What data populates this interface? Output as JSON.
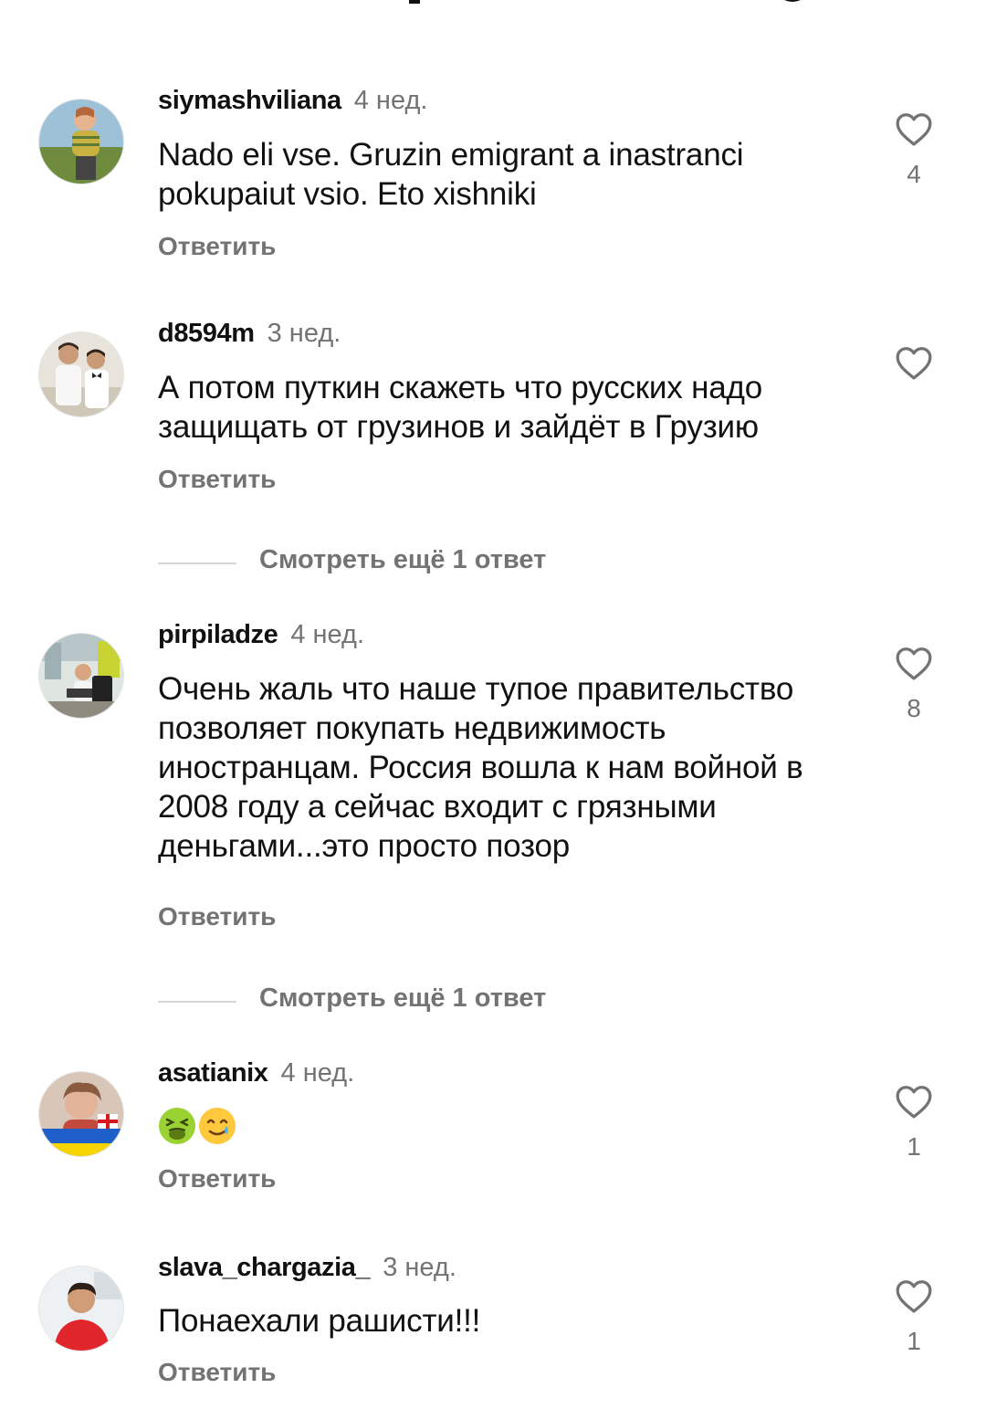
{
  "comments": [
    {
      "username": "siymashviliana",
      "time": "4 нед.",
      "text": "Nado eli vse. Gruzin emigrant a inastranci pokupaiut vsio. Eto xishniki",
      "likes": "4",
      "reply_label": "Ответить"
    },
    {
      "username": "d8594m",
      "time": "3 нед.",
      "text": "А потом путкин скажеть что русских надо защищать от грузинов и зайдёт в Грузию",
      "likes": "",
      "reply_label": "Ответить"
    },
    {
      "username": "pirpiladze",
      "time": "4 нед.",
      "text": "Очень жаль что наше тупое правительство позволяет покупать недвижимость иностранцам. Россия вошла к нам войной в 2008 году а сейчас входит с грязными деньгами...это просто позор",
      "likes": "8",
      "reply_label": "Ответить"
    },
    {
      "username": "asatianix",
      "time": "4 нед.",
      "text": "",
      "emoji": [
        "nauseated-face-emoji",
        "smiling-face-with-tear-emoji"
      ],
      "likes": "1",
      "reply_label": "Ответить",
      "avatar_badge": "I SUPPORT UKRAINE!"
    },
    {
      "username": "slava_chargazia_",
      "time": "3 нед.",
      "text": "Понаехали рашисти!!!",
      "likes": "1",
      "reply_label": "Ответить"
    }
  ],
  "view_replies": [
    {
      "label": "Смотреть ещё 1 ответ"
    },
    {
      "label": "Смотреть ещё 1 ответ"
    }
  ],
  "icons": {
    "like": "heart-outline-icon"
  },
  "colors": {
    "text": "#111111",
    "secondary": "#737373",
    "divider": "#d6d6d6"
  }
}
